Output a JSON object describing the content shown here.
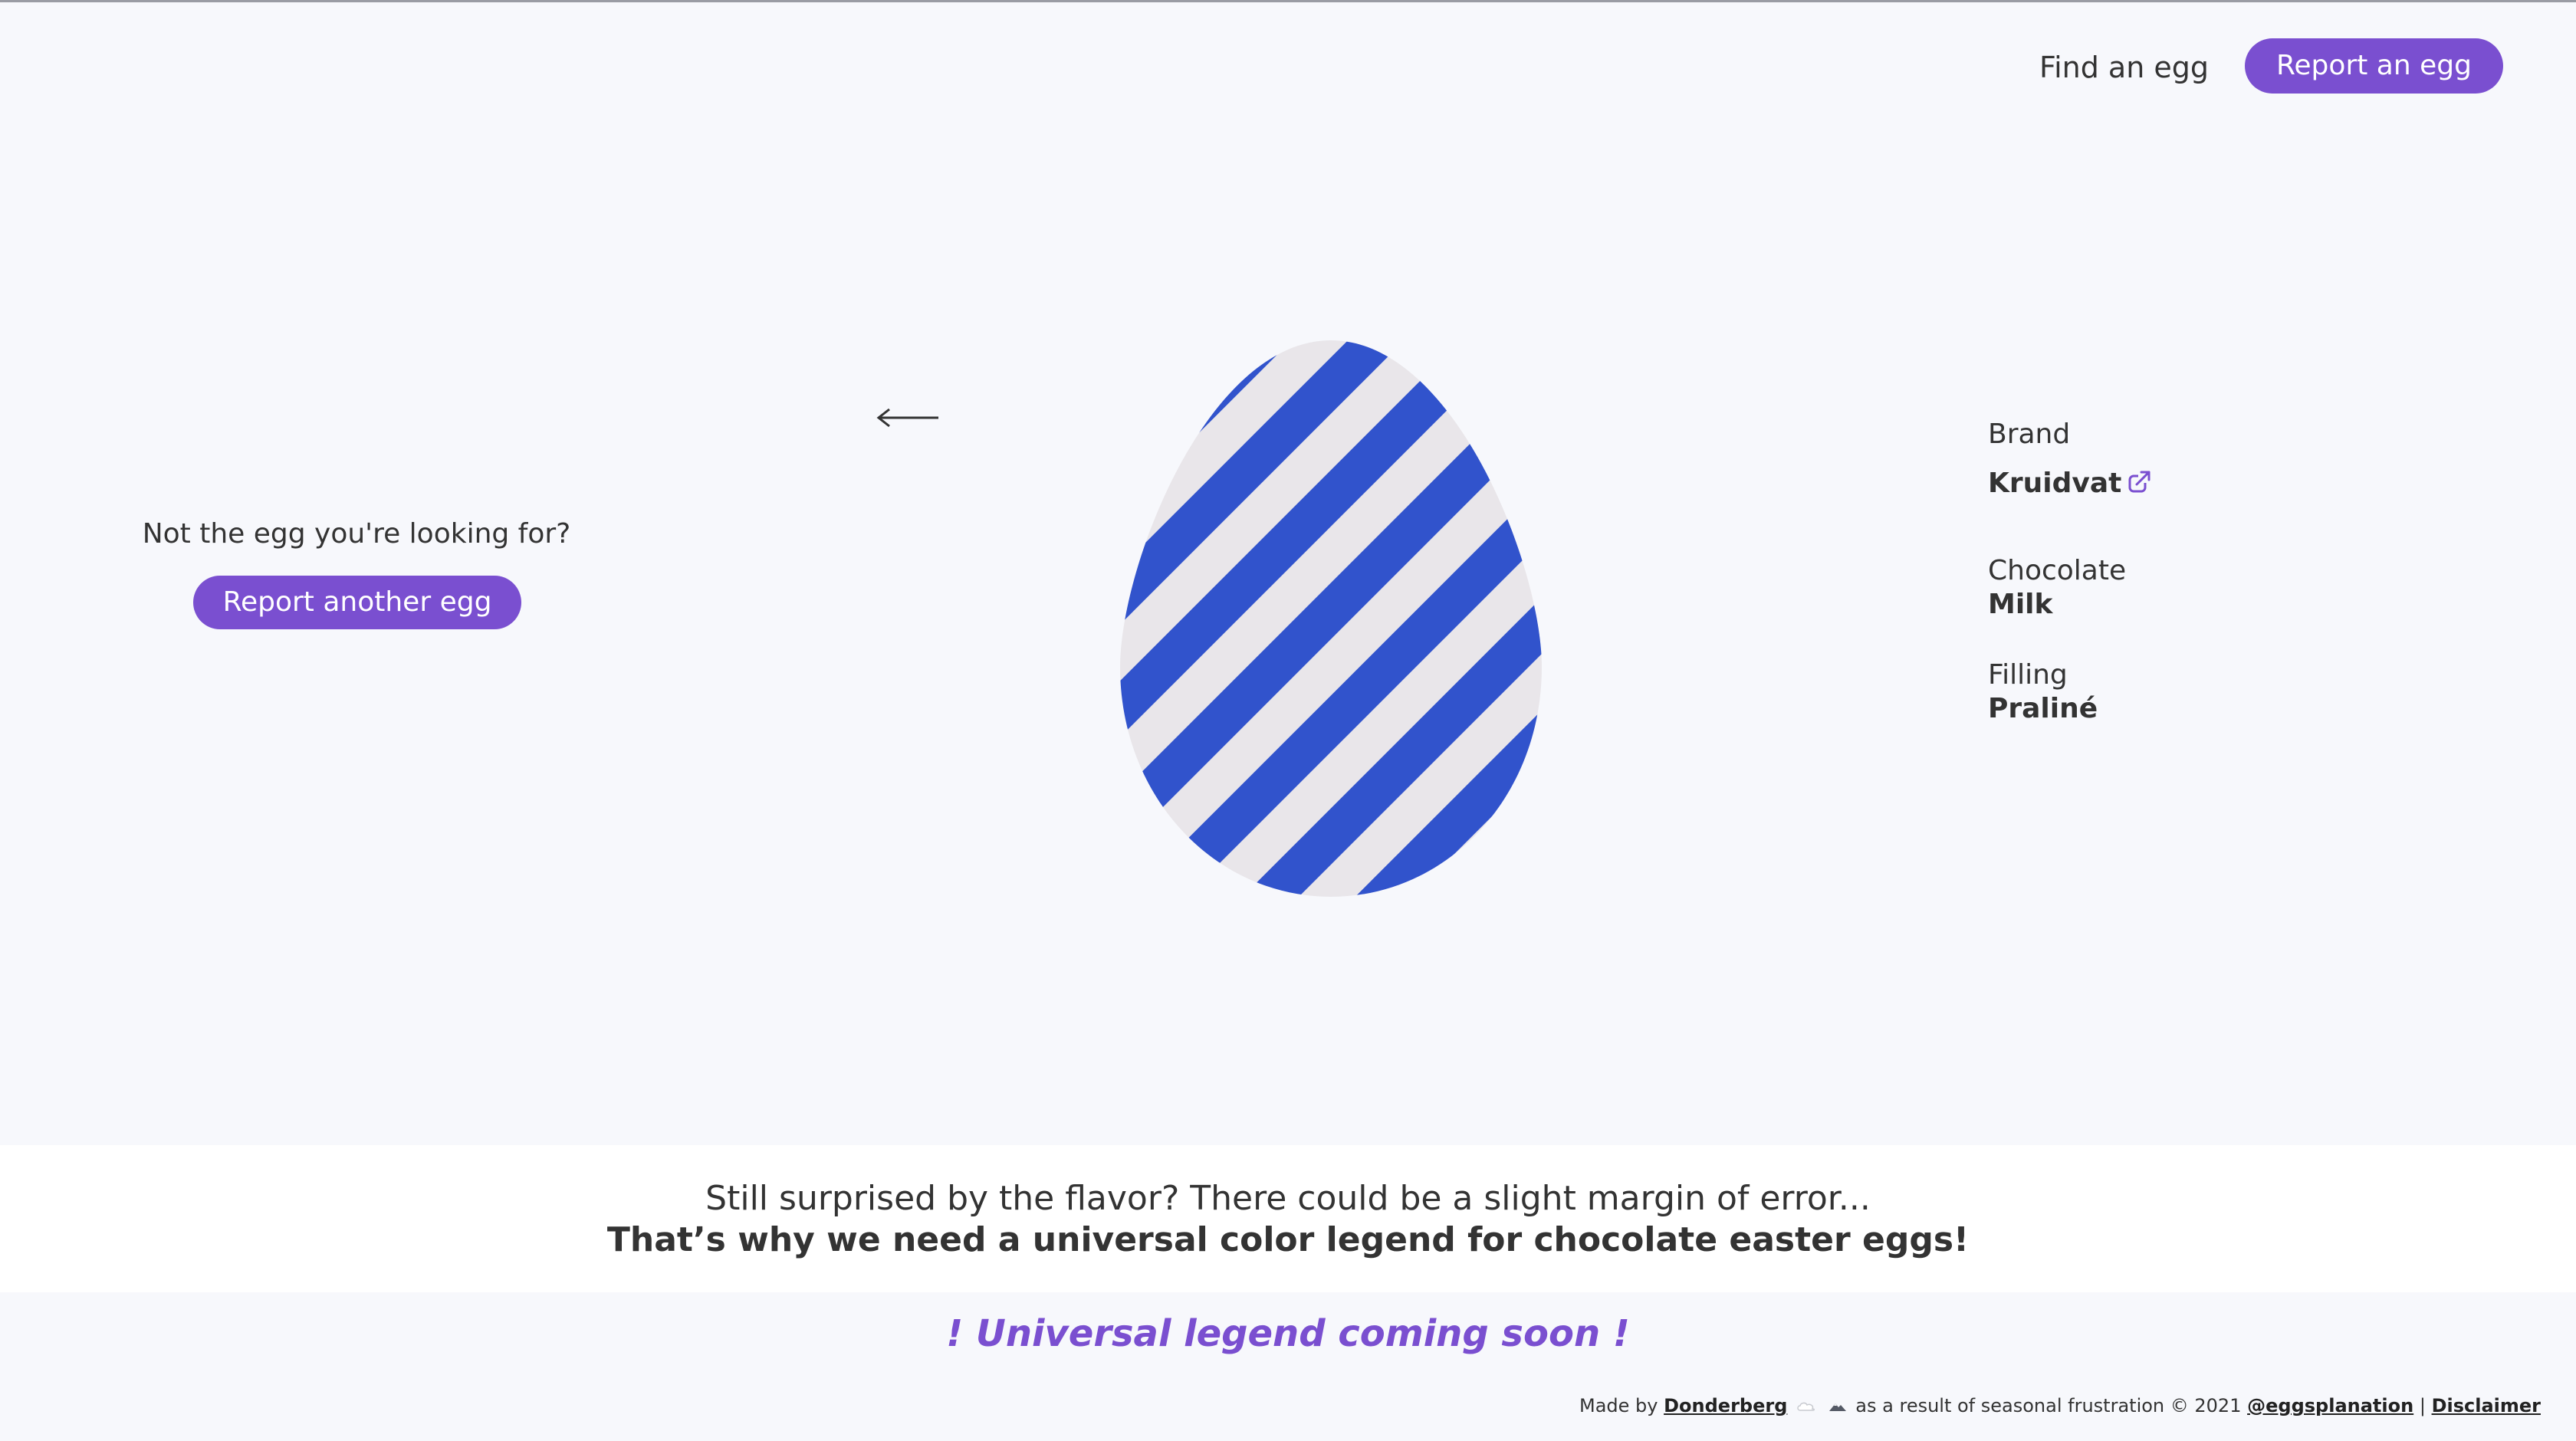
{
  "header": {
    "find_label": "Find an egg",
    "report_label": "Report an egg"
  },
  "left_panel": {
    "question": "Not the egg you're looking for?",
    "report_another_label": "Report another egg"
  },
  "navigation": {
    "back_icon": "arrow-left-icon"
  },
  "egg": {
    "stripe_color": "#3153cc",
    "base_color": "#e9e6ea"
  },
  "details": {
    "brand_label": "Brand",
    "brand_value": "Kruidvat",
    "brand_link_icon": "external-link-icon",
    "chocolate_label": "Chocolate",
    "chocolate_value": "Milk",
    "filling_label": "Filling",
    "filling_value": "Praliné"
  },
  "banner": {
    "line1": "Still surprised by the flavor? There could be a slight margin of error...",
    "line2": "That’s why we need a universal color legend for chocolate easter eggs!"
  },
  "coming_soon": "! Universal legend coming soon !",
  "footer": {
    "made_by": "Made by",
    "author": "Donderberg",
    "middle_text": "as a result of seasonal frustration © 2021",
    "handle": "@eggsplanation",
    "separator": "|",
    "disclaimer": "Disclaimer"
  },
  "colors": {
    "accent": "#7a4fd0",
    "background": "#f7f8fc",
    "text": "#333333"
  }
}
